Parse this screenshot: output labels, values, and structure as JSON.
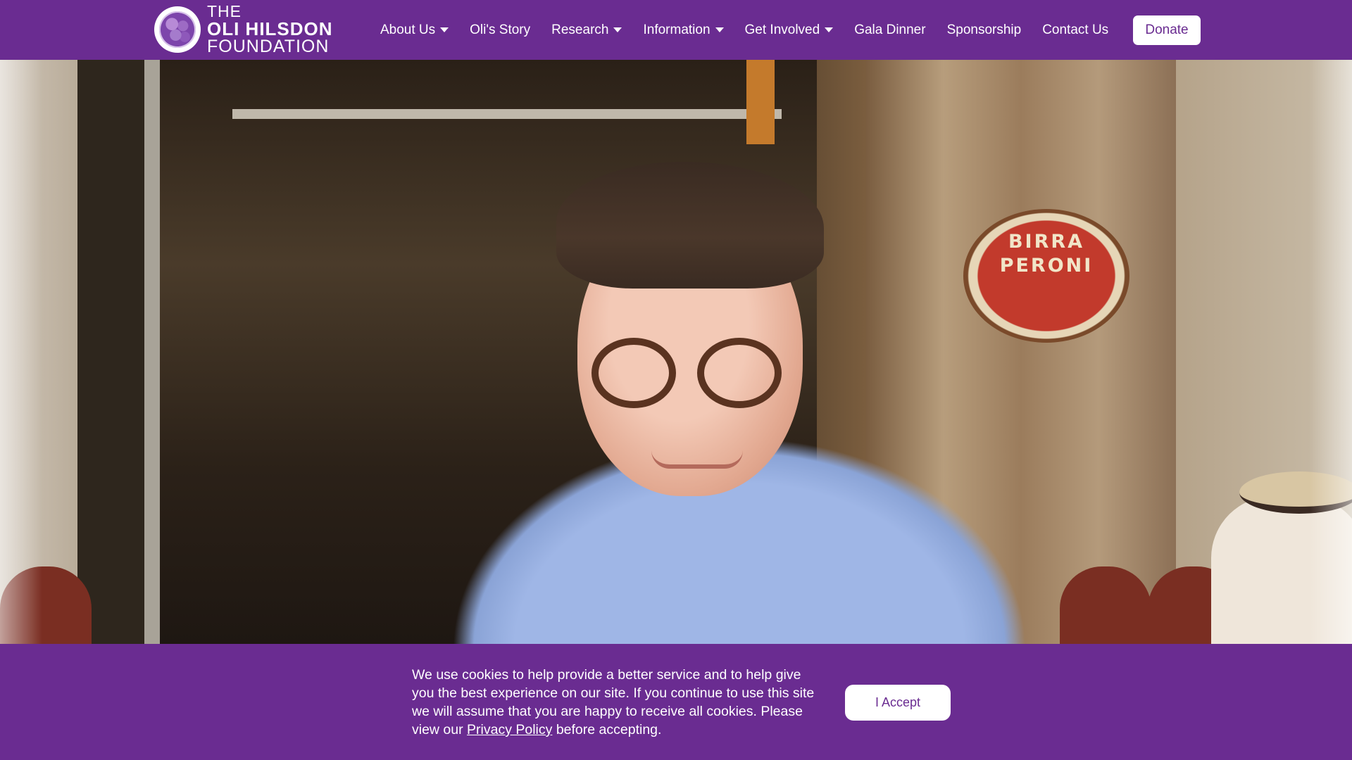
{
  "brand": {
    "logo_line1": "THE",
    "logo_line2": "OLI HILSDON",
    "logo_line3": "FOUNDATION",
    "accent_color": "#6a2c91"
  },
  "nav": {
    "items": [
      {
        "label": "About Us",
        "has_dropdown": true
      },
      {
        "label": "Oli's Story",
        "has_dropdown": false
      },
      {
        "label": "Research",
        "has_dropdown": true
      },
      {
        "label": "Information",
        "has_dropdown": true
      },
      {
        "label": "Get Involved",
        "has_dropdown": true
      },
      {
        "label": "Gala Dinner",
        "has_dropdown": false
      },
      {
        "label": "Sponsorship",
        "has_dropdown": false
      },
      {
        "label": "Contact Us",
        "has_dropdown": false
      }
    ],
    "donate_label": "Donate"
  },
  "hero": {
    "sign_line1": "BIRRA",
    "sign_line2": "PERONI"
  },
  "cookie": {
    "text_before_link": "We use cookies to help provide a better service and to help give you the best experience on our site. If you continue to use this site we will assume that you are happy to receive all cookies. Please view our ",
    "link_label": "Privacy Policy",
    "text_after_link": " before accepting.",
    "accept_label": "I Accept"
  }
}
